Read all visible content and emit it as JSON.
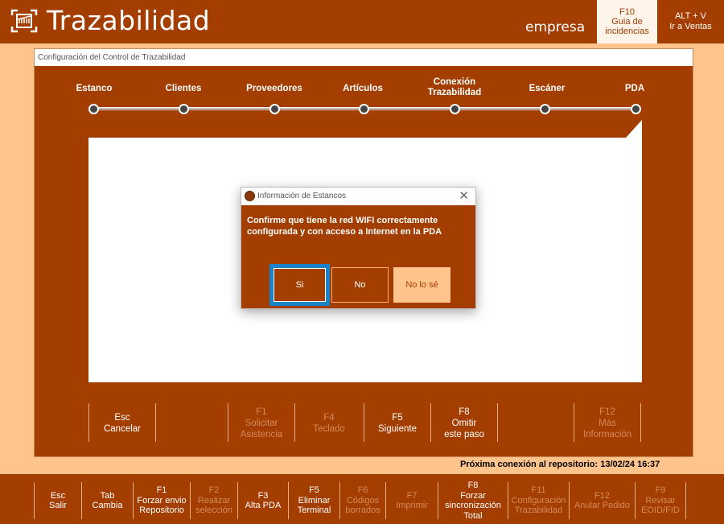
{
  "header": {
    "app_title": "Trazabilidad",
    "company": "empresa",
    "f10": {
      "key": "F10",
      "line1": "Guia de",
      "line2": "incidencias"
    },
    "altv": {
      "key": "ALT + V",
      "label": "Ir a Ventas"
    }
  },
  "window": {
    "title": "Configuración del Control de Trazabilidad",
    "steps": [
      {
        "line1": "Estanco",
        "line2": ""
      },
      {
        "line1": "Clientes",
        "line2": ""
      },
      {
        "line1": "Proveedores",
        "line2": ""
      },
      {
        "line1": "Artículos",
        "line2": ""
      },
      {
        "line1": "Conexión",
        "line2": "Trazabilidad"
      },
      {
        "line1": "Escáner",
        "line2": ""
      },
      {
        "line1": "PDA",
        "line2": ""
      }
    ],
    "buttons": [
      {
        "key": "Esc",
        "line1": "Cancelar",
        "line2": ""
      },
      {
        "key": "F1",
        "line1": "Solicitar",
        "line2": "Asistencia"
      },
      {
        "key": "F4",
        "line1": "Teclado",
        "line2": ""
      },
      {
        "key": "F5",
        "line1": "Siguiente",
        "line2": ""
      },
      {
        "key": "F8",
        "line1": "Omitir",
        "line2": "este paso"
      },
      {
        "key": "F12",
        "line1": "Más",
        "line2": "Información"
      }
    ]
  },
  "status": "Próxima conexión al repositorio: 13/02/24 16:37",
  "dialog": {
    "title": "Información de Estancos",
    "message": "Confirme que tiene la red WIFI correctamente configurada y con acceso a Internet en la PDA",
    "yes": "Si",
    "no": "No",
    "dont_know": "No lo sé"
  },
  "footer": [
    {
      "key": "Esc",
      "line1": "Salir",
      "line2": ""
    },
    {
      "key": "Tab",
      "line1": "Cambia",
      "line2": ""
    },
    {
      "key": "F1",
      "line1": "Forzar envio",
      "line2": "Repositorio"
    },
    {
      "key": "F2",
      "line1": "Realizar",
      "line2": "selección"
    },
    {
      "key": "F3",
      "line1": "Alta PDA",
      "line2": ""
    },
    {
      "key": "F5",
      "line1": "Eliminar",
      "line2": "Terminal"
    },
    {
      "key": "F6",
      "line1": "Códigos",
      "line2": "borrados"
    },
    {
      "key": "F7",
      "line1": "Imprimir",
      "line2": ""
    },
    {
      "key": "F8",
      "line1": "Forzar",
      "line2": "sincronización",
      "line3": "Total"
    },
    {
      "key": "F11",
      "line1": "Configuración",
      "line2": "Trazabilidad"
    },
    {
      "key": "F12",
      "line1": "Anular Pedido",
      "line2": ""
    },
    {
      "key": "F9",
      "line1": "Revisar",
      "line2": "EOID/FID"
    }
  ]
}
